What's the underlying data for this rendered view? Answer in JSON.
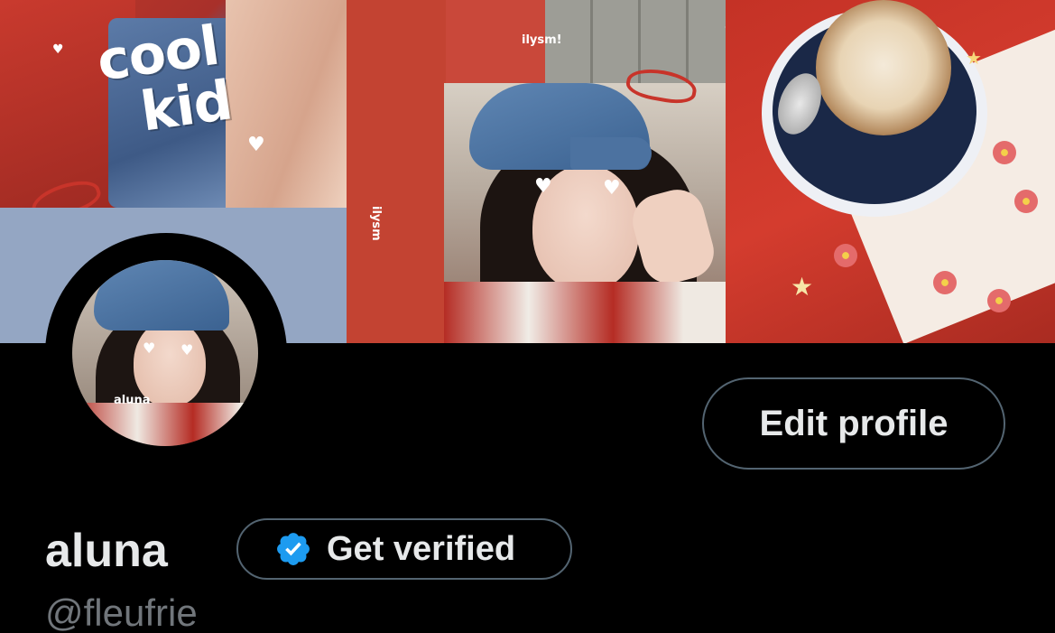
{
  "banner": {
    "text_cool": "cool",
    "text_kid": "kid",
    "sticker_ilysm_vertical": "ilysm",
    "sticker_ilysm": "ilysm!"
  },
  "avatar": {
    "caption": "aluna"
  },
  "profile": {
    "edit_label": "Edit profile",
    "display_name": "aluna",
    "verify_label": "Get verified",
    "handle": "@fleufrie"
  },
  "colors": {
    "background": "#000000",
    "text_primary": "#e7e9ea",
    "text_secondary": "#71767b",
    "button_border": "#536471",
    "verified_blue": "#1d9bf0"
  },
  "icons": {
    "verified": "verified-badge-icon"
  }
}
